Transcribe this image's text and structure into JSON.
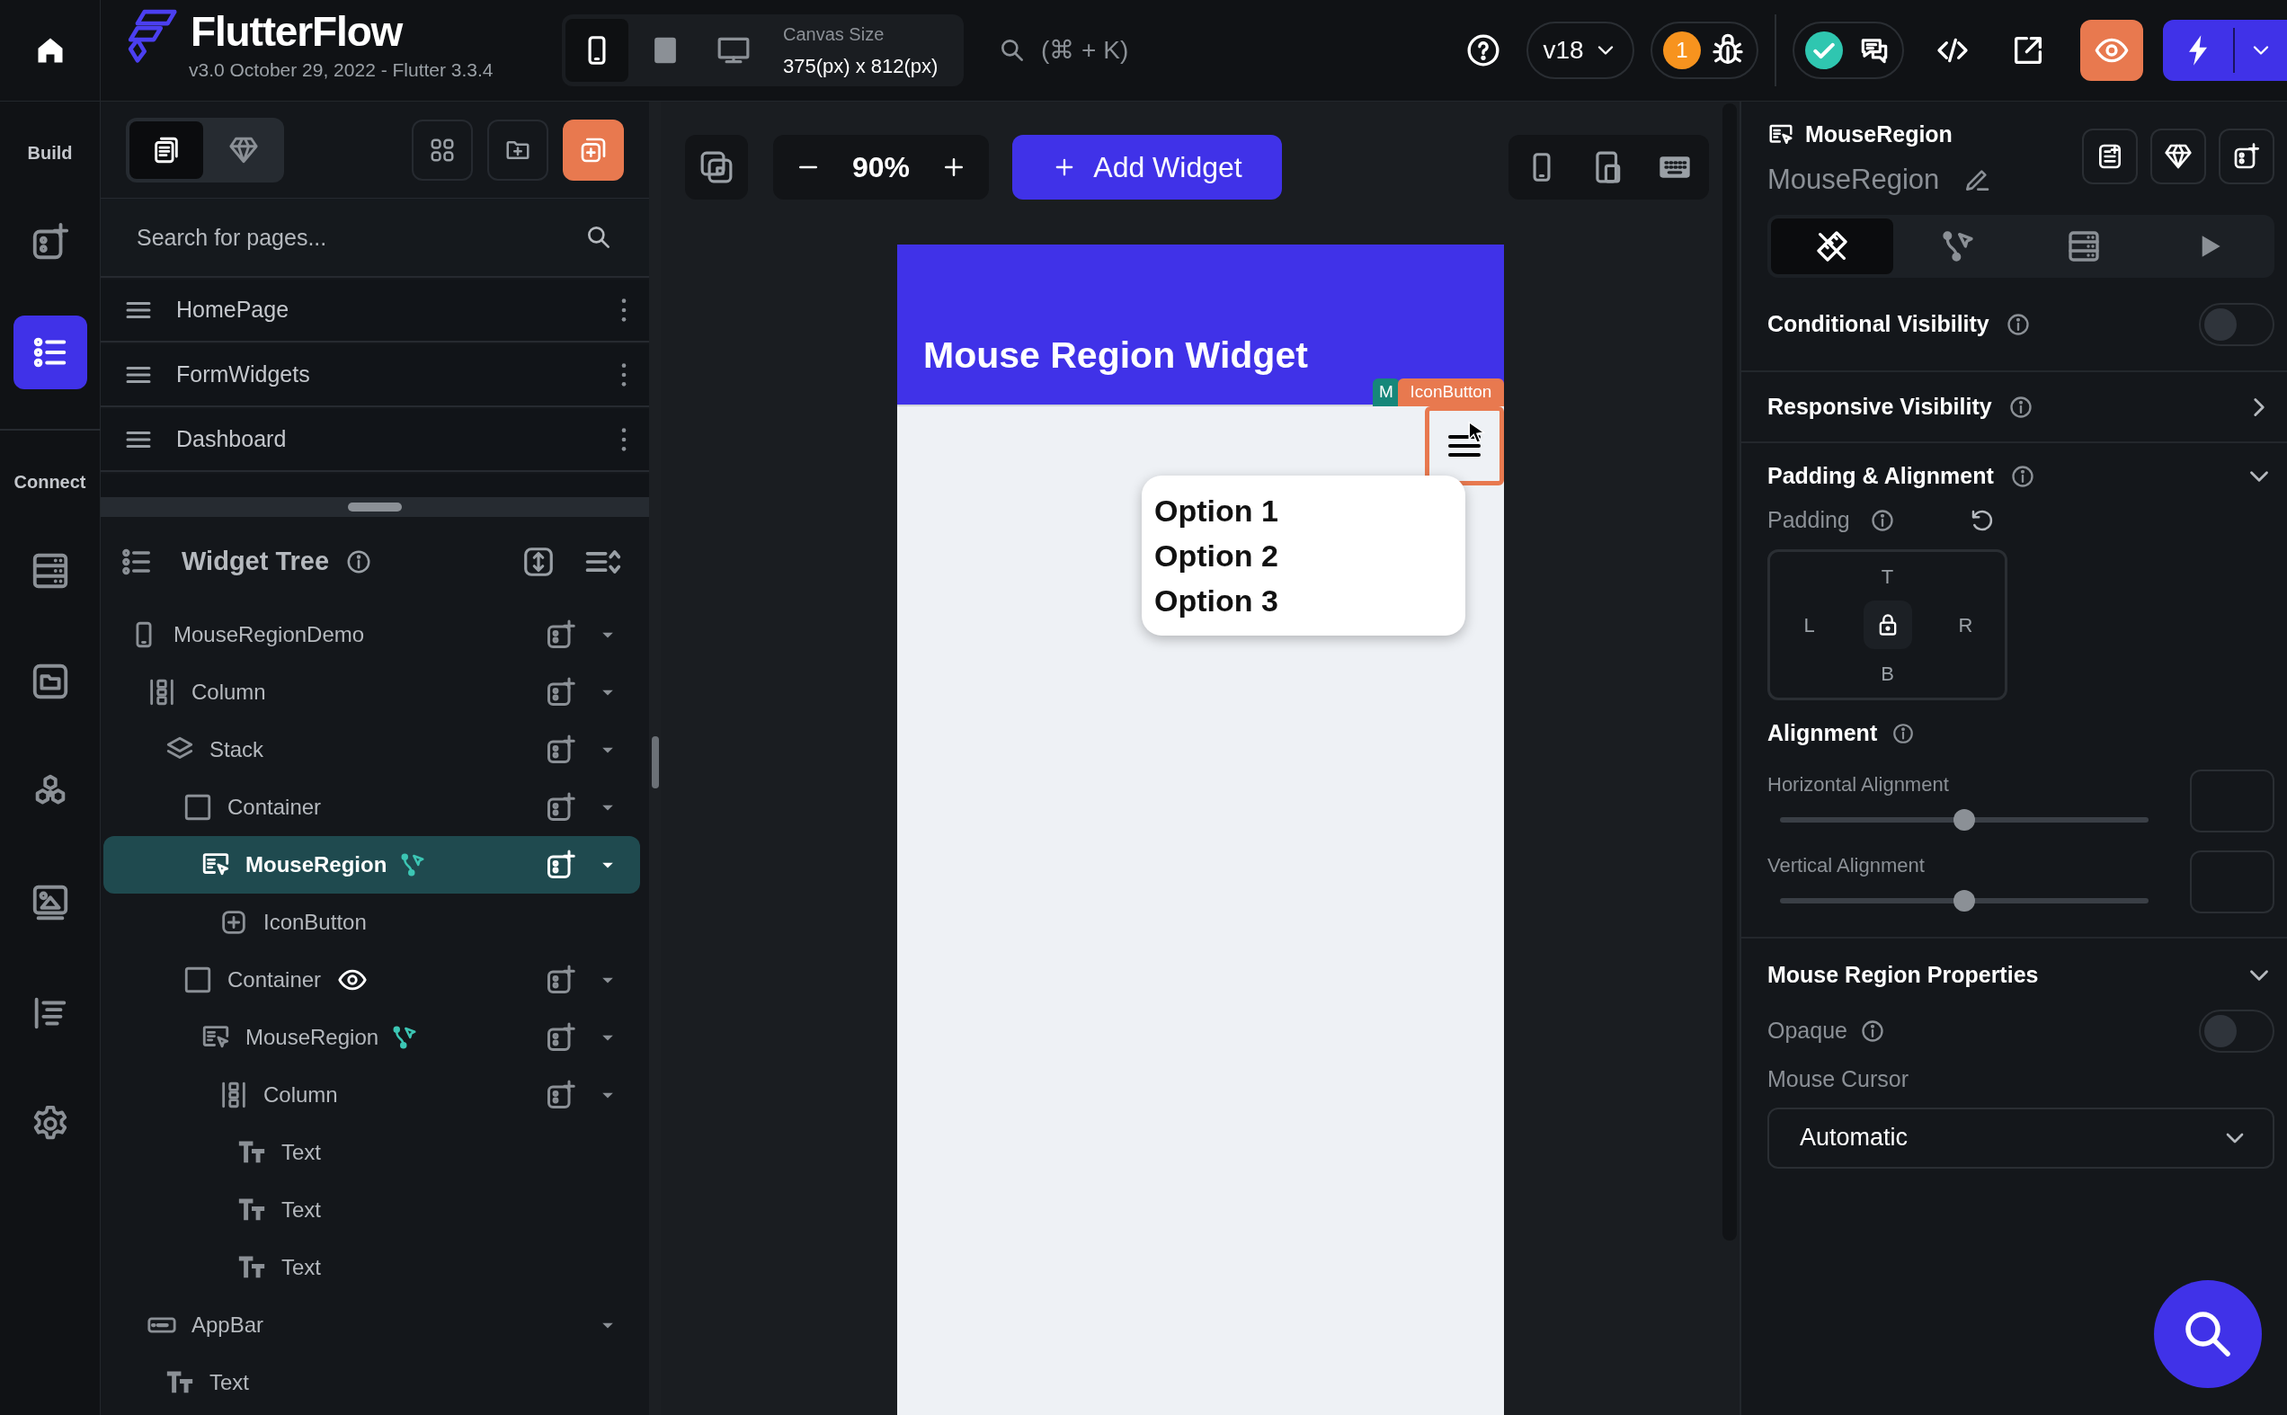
{
  "topbar": {
    "logo_text": "FlutterFlow",
    "version": "v3.0 October 29, 2022 - Flutter 3.3.4",
    "device_modes": [
      {
        "kind": "phone",
        "selected": true
      },
      {
        "kind": "tablet",
        "selected": false
      },
      {
        "kind": "desktop",
        "selected": false
      }
    ],
    "canvas_size_label": "Canvas Size",
    "canvas_size": "375(px) x 812(px)",
    "search_shortcut": "(⌘ + K)",
    "version_tag": "v18",
    "issue_count": "1"
  },
  "rail": {
    "sections": [
      {
        "label": "Build",
        "items": [
          {
            "kind": "add-widget",
            "selected": false
          },
          {
            "kind": "widget-tree",
            "selected": true
          }
        ]
      },
      {
        "label": "Connect",
        "items": [
          {
            "kind": "database",
            "selected": false
          },
          {
            "kind": "storage",
            "selected": false
          },
          {
            "kind": "integrations",
            "selected": false
          },
          {
            "kind": "media",
            "selected": false
          },
          {
            "kind": "text-styles",
            "selected": false
          },
          {
            "kind": "settings",
            "selected": false
          }
        ]
      }
    ]
  },
  "pages_panel": {
    "tabs": [
      {
        "kind": "pages",
        "selected": true
      },
      {
        "kind": "components",
        "selected": false
      }
    ],
    "search": {
      "placeholder": "Search for pages..."
    },
    "pages": [
      {
        "label": "HomePage"
      },
      {
        "label": "FormWidgets"
      },
      {
        "label": "Dashboard"
      }
    ]
  },
  "widget_tree": {
    "title": "Widget Tree",
    "nodes": [
      {
        "label": "MouseRegionDemo",
        "kind": "page",
        "selected": false,
        "has_actions": false,
        "visibility_condition": false,
        "children": [
          {
            "label": "Column",
            "kind": "column",
            "selected": false,
            "has_actions": false,
            "visibility_condition": false,
            "children": [
              {
                "label": "Stack",
                "kind": "stack",
                "selected": false,
                "has_actions": false,
                "visibility_condition": false,
                "children": [
                  {
                    "label": "Container",
                    "kind": "container",
                    "selected": false,
                    "has_actions": false,
                    "visibility_condition": false,
                    "children": [
                      {
                        "label": "MouseRegion",
                        "kind": "mouse-region",
                        "selected": true,
                        "has_actions": true,
                        "visibility_condition": false,
                        "children": [
                          {
                            "label": "IconButton",
                            "kind": "icon-button",
                            "selected": false,
                            "has_actions": false,
                            "visibility_condition": false
                          }
                        ]
                      }
                    ]
                  },
                  {
                    "label": "Container",
                    "kind": "container",
                    "selected": false,
                    "has_actions": false,
                    "visibility_condition": true,
                    "children": [
                      {
                        "label": "MouseRegion",
                        "kind": "mouse-region",
                        "selected": false,
                        "has_actions": true,
                        "visibility_condition": false,
                        "children": [
                          {
                            "label": "Column",
                            "kind": "column",
                            "selected": false,
                            "has_actions": false,
                            "visibility_condition": false,
                            "children": [
                              {
                                "label": "Text",
                                "kind": "text",
                                "selected": false,
                                "has_actions": false,
                                "visibility_condition": false
                              },
                              {
                                "label": "Text",
                                "kind": "text",
                                "selected": false,
                                "has_actions": false,
                                "visibility_condition": false
                              },
                              {
                                "label": "Text",
                                "kind": "text",
                                "selected": false,
                                "has_actions": false,
                                "visibility_condition": false
                              }
                            ]
                          }
                        ]
                      }
                    ]
                  }
                ]
              }
            ]
          },
          {
            "label": "AppBar",
            "kind": "appbar",
            "selected": false,
            "has_actions": false,
            "visibility_condition": false,
            "children": [
              {
                "label": "Text",
                "kind": "text",
                "selected": false,
                "has_actions": false,
                "visibility_condition": false
              }
            ]
          }
        ]
      }
    ]
  },
  "canvas": {
    "zoom": "90%",
    "add_widget": "Add Widget",
    "app_title": "Mouse Region Widget",
    "tags": [
      {
        "label": "M",
        "color": "#16877a"
      },
      {
        "label": "IconButton",
        "color": "#e8794f"
      }
    ],
    "menu_options": [
      "Option 1",
      "Option 2",
      "Option 3"
    ]
  },
  "properties": {
    "widget_type": "MouseRegion",
    "widget_name": "MouseRegion",
    "tabs": [
      {
        "kind": "properties",
        "selected": true
      },
      {
        "kind": "actions",
        "selected": false
      },
      {
        "kind": "backend",
        "selected": false
      },
      {
        "kind": "preview",
        "selected": false
      }
    ],
    "conditional_visibility": {
      "label": "Conditional Visibility",
      "on": false
    },
    "responsive_visibility": {
      "label": "Responsive Visibility",
      "expanded": false
    },
    "padding_alignment": {
      "label": "Padding & Alignment",
      "expanded": true,
      "padding_label": "Padding",
      "sides": {
        "top": "T",
        "left": "L",
        "right": "R",
        "bottom": "B"
      },
      "alignment_label": "Alignment",
      "sliders": [
        {
          "label": "Horizontal Alignment",
          "level": 0.5
        },
        {
          "label": "Vertical Alignment",
          "level": 0.5
        }
      ]
    },
    "mouse_region": {
      "label": "Mouse Region Properties",
      "expanded": true,
      "opaque": {
        "label": "Opaque",
        "on": false
      },
      "cursor_label": "Mouse Cursor",
      "cursor_value": "Automatic"
    }
  }
}
